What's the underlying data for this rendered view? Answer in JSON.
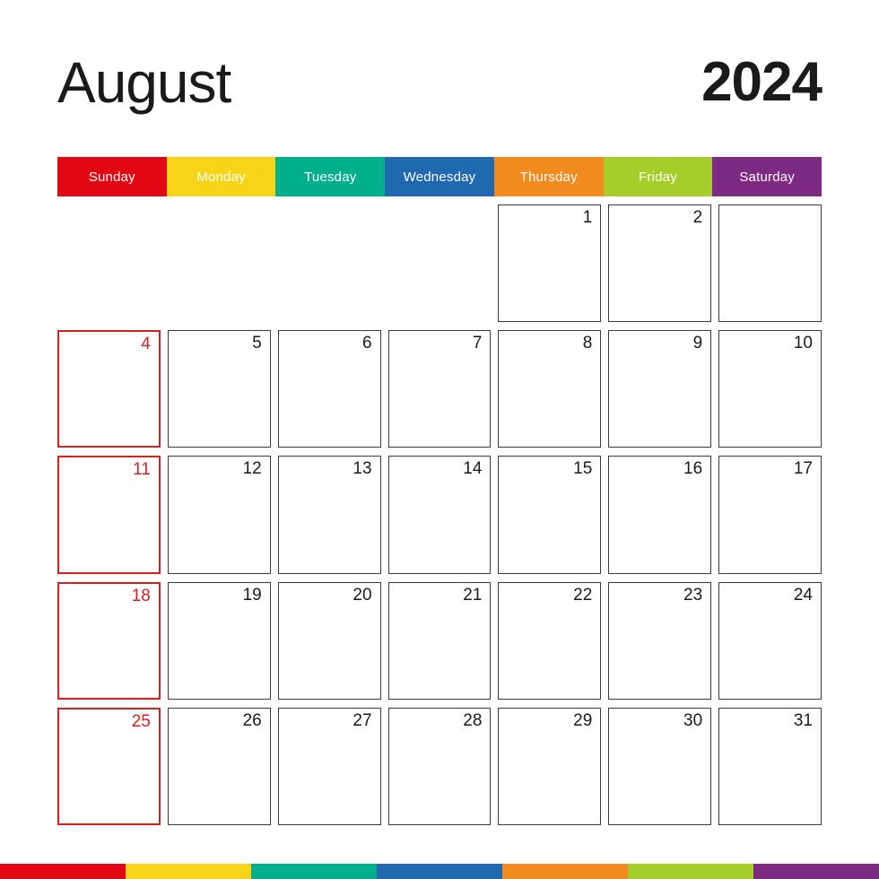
{
  "header": {
    "month": "August",
    "year": "2024"
  },
  "weekdays": [
    {
      "label": "Sunday",
      "color": "#E30613"
    },
    {
      "label": "Monday",
      "color": "#F7D417"
    },
    {
      "label": "Tuesday",
      "color": "#00B08B"
    },
    {
      "label": "Wednesday",
      "color": "#2069B0"
    },
    {
      "label": "Thursday",
      "color": "#F28B20"
    },
    {
      "label": "Friday",
      "color": "#A5CE28"
    },
    {
      "label": "Saturday",
      "color": "#7D2A82"
    }
  ],
  "colors": {
    "sunday_accent": "#D82020",
    "cell_border": "#3A3A3A",
    "text": "#1A1A18",
    "background": "#FFFFFF"
  },
  "calendar": {
    "weeks": [
      [
        {
          "day": "",
          "box": false,
          "sunday": true
        },
        {
          "day": "",
          "box": false,
          "sunday": false
        },
        {
          "day": "",
          "box": false,
          "sunday": false
        },
        {
          "day": "",
          "box": false,
          "sunday": false
        },
        {
          "day": "1",
          "box": true,
          "sunday": false
        },
        {
          "day": "2",
          "box": true,
          "sunday": false
        },
        {
          "day": "",
          "box": true,
          "sunday": false
        }
      ],
      [
        {
          "day": "4",
          "box": true,
          "sunday": true
        },
        {
          "day": "5",
          "box": true,
          "sunday": false
        },
        {
          "day": "6",
          "box": true,
          "sunday": false
        },
        {
          "day": "7",
          "box": true,
          "sunday": false
        },
        {
          "day": "8",
          "box": true,
          "sunday": false
        },
        {
          "day": "9",
          "box": true,
          "sunday": false
        },
        {
          "day": "10",
          "box": true,
          "sunday": false
        }
      ],
      [
        {
          "day": "11",
          "box": true,
          "sunday": true
        },
        {
          "day": "12",
          "box": true,
          "sunday": false
        },
        {
          "day": "13",
          "box": true,
          "sunday": false
        },
        {
          "day": "14",
          "box": true,
          "sunday": false
        },
        {
          "day": "15",
          "box": true,
          "sunday": false
        },
        {
          "day": "16",
          "box": true,
          "sunday": false
        },
        {
          "day": "17",
          "box": true,
          "sunday": false
        }
      ],
      [
        {
          "day": "18",
          "box": true,
          "sunday": true
        },
        {
          "day": "19",
          "box": true,
          "sunday": false
        },
        {
          "day": "20",
          "box": true,
          "sunday": false
        },
        {
          "day": "21",
          "box": true,
          "sunday": false
        },
        {
          "day": "22",
          "box": true,
          "sunday": false
        },
        {
          "day": "23",
          "box": true,
          "sunday": false
        },
        {
          "day": "24",
          "box": true,
          "sunday": false
        }
      ],
      [
        {
          "day": "25",
          "box": true,
          "sunday": true
        },
        {
          "day": "26",
          "box": true,
          "sunday": false
        },
        {
          "day": "27",
          "box": true,
          "sunday": false
        },
        {
          "day": "28",
          "box": true,
          "sunday": false
        },
        {
          "day": "29",
          "box": true,
          "sunday": false
        },
        {
          "day": "30",
          "box": true,
          "sunday": false
        },
        {
          "day": "31",
          "box": true,
          "sunday": false
        }
      ]
    ]
  },
  "bottom_strip": {
    "bands": [
      "#E30613",
      "#F7D417",
      "#00B08B",
      "#2069B0",
      "#F28B20",
      "#A5CE28",
      "#7D2A82"
    ]
  }
}
